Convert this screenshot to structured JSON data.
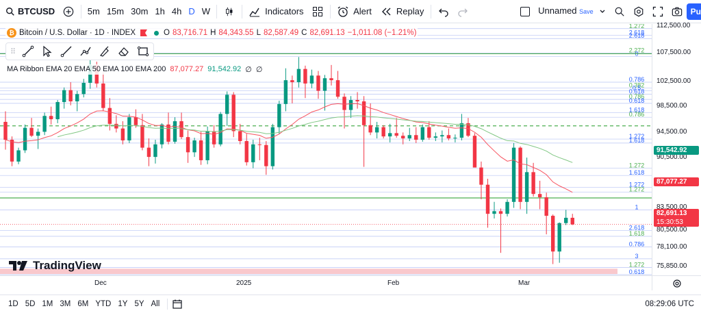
{
  "toolbar": {
    "symbol": "BTCUSD",
    "timeframes": [
      "5m",
      "15m",
      "30m",
      "1h",
      "4h",
      "D",
      "W"
    ],
    "active_timeframe": "D",
    "indicators_label": "Indicators",
    "alert_label": "Alert",
    "replay_label": "Replay",
    "layout_name": "Unnamed",
    "layout_status": "Save",
    "publish_label": "Pu"
  },
  "legend": {
    "title": "Bitcoin / U.S. Dollar · 1D · INDEX",
    "open_label": "O",
    "open": "83,716.71",
    "high_label": "H",
    "high": "84,343.55",
    "low_label": "L",
    "low": "82,587.49",
    "close_label": "C",
    "close": "82,691.13",
    "change": "−1,011.08 (−1.21%)"
  },
  "ma_legend": {
    "label": "MA Ribbon EMA 20 EMA 50 EMA 100 EMA 200",
    "v1": "87,077.27",
    "v2": "91,542.92",
    "v3": "∅",
    "v4": "∅"
  },
  "price_axis": {
    "ticks": [
      "112,500.00",
      "107,500.00",
      "102,500.00",
      "98,500.00",
      "94,500.00",
      "90,500.00",
      "83,500.00",
      "80,500.00",
      "78,100.00",
      "75,850.00"
    ],
    "tag_green": "91,542.92",
    "tag_red": "87,077.27",
    "tag_current": "82,691.13",
    "tag_timer": "15:30:53"
  },
  "time_axis": {
    "ticks": [
      "Dec",
      "2025",
      "Feb",
      "Mar"
    ]
  },
  "fib_labels": [
    "1.272",
    "2.618",
    "2.618",
    "2.272",
    "0",
    "0.786",
    "0.382",
    "0.5",
    "0.618",
    "0.786",
    "0.618",
    "1.618",
    "0.786",
    "1.272",
    "1.618",
    "1.272",
    "1.618",
    "1.272",
    "1.272",
    "1",
    "2.618",
    "1.618",
    "0.786",
    "3",
    "1.272",
    "0.618"
  ],
  "bottombar": {
    "ranges": [
      "1D",
      "5D",
      "1M",
      "3M",
      "6M",
      "YTD",
      "1Y",
      "5Y",
      "All"
    ],
    "clock": "08:29:06 UTC"
  },
  "branding": {
    "logo_text": "TradingView"
  },
  "colors": {
    "up": "#089981",
    "down": "#f23645",
    "accent": "#2962ff",
    "ema_fast": "#f7525f",
    "ema_slow": "#81c784"
  },
  "chart_data": {
    "type": "candlestick",
    "ylim": [
      75000,
      113000
    ],
    "candles": [
      [
        98200,
        99800,
        94000,
        95500
      ],
      [
        95500,
        96000,
        91500,
        92200
      ],
      [
        92200,
        94300,
        91800,
        93900
      ],
      [
        93900,
        97800,
        93500,
        97300
      ],
      [
        97300,
        98800,
        95900,
        96100
      ],
      [
        96100,
        97200,
        94100,
        96700
      ],
      [
        96700,
        99600,
        96200,
        99100
      ],
      [
        99100,
        100500,
        97800,
        98600
      ],
      [
        98600,
        101500,
        98000,
        101200
      ],
      [
        101200,
        103400,
        100200,
        103000
      ],
      [
        103000,
        104200,
        100700,
        101300
      ],
      [
        101300,
        102900,
        99800,
        102400
      ],
      [
        102400,
        104700,
        101900,
        104100
      ],
      [
        104100,
        108300,
        103200,
        106800
      ],
      [
        106800,
        107300,
        103400,
        104000
      ],
      [
        104000,
        105700,
        99800,
        100300
      ],
      [
        100300,
        101800,
        96900,
        97900
      ],
      [
        97900,
        99200,
        96600,
        97200
      ],
      [
        97200,
        98300,
        94800,
        95400
      ],
      [
        95400,
        99400,
        95000,
        98900
      ],
      [
        98900,
        100100,
        97300,
        97700
      ],
      [
        97700,
        99400,
        93900,
        94300
      ],
      [
        94300,
        95700,
        91500,
        92900
      ],
      [
        92900,
        95500,
        91900,
        94800
      ],
      [
        94800,
        98000,
        94200,
        97800
      ],
      [
        97800,
        99600,
        94800,
        95200
      ],
      [
        95200,
        98900,
        94900,
        98300
      ],
      [
        98300,
        99600,
        95600,
        95900
      ],
      [
        95900,
        96900,
        92000,
        93600
      ],
      [
        93600,
        95800,
        92900,
        95400
      ],
      [
        95400,
        96700,
        91700,
        92400
      ],
      [
        92400,
        97500,
        91800,
        96800
      ],
      [
        96800,
        97700,
        94300,
        94800
      ],
      [
        94800,
        99700,
        94500,
        99400
      ],
      [
        99400,
        102800,
        97600,
        102300
      ],
      [
        102300,
        102700,
        95900,
        96800
      ],
      [
        96800,
        97900,
        94800,
        95300
      ],
      [
        95300,
        96400,
        91600,
        92100
      ],
      [
        92100,
        95500,
        91200,
        94800
      ],
      [
        94800,
        95800,
        92400,
        94700
      ],
      [
        94700,
        95300,
        90200,
        91500
      ],
      [
        91500,
        97900,
        91000,
        97400
      ],
      [
        97400,
        101400,
        96400,
        100900
      ],
      [
        100900,
        106300,
        99800,
        104500
      ],
      [
        104500,
        105200,
        101000,
        104200
      ],
      [
        104200,
        108000,
        103400,
        106200
      ],
      [
        106200,
        106700,
        101800,
        104000
      ],
      [
        104000,
        106100,
        103300,
        105200
      ],
      [
        105200,
        105900,
        101700,
        102900
      ],
      [
        102900,
        105300,
        99900,
        104800
      ],
      [
        104800,
        106800,
        103700,
        104500
      ],
      [
        104500,
        105900,
        101700,
        102000
      ],
      [
        102000,
        102500,
        97200,
        100000
      ],
      [
        100000,
        102100,
        98800,
        101500
      ],
      [
        101500,
        102700,
        100200,
        101300
      ],
      [
        101300,
        102100,
        91400,
        97700
      ],
      [
        97700,
        101000,
        96200,
        96600
      ],
      [
        96600,
        98200,
        95700,
        97400
      ],
      [
        97400,
        97700,
        95700,
        96000
      ],
      [
        96000,
        97900,
        95100,
        96500
      ],
      [
        96500,
        98800,
        95800,
        96100
      ],
      [
        96100,
        96600,
        94800,
        95700
      ],
      [
        95700,
        97300,
        95300,
        96200
      ],
      [
        96200,
        97400,
        95000,
        95500
      ],
      [
        95500,
        97800,
        95200,
        97400
      ],
      [
        97400,
        98300,
        95500,
        95800
      ],
      [
        95800,
        96600,
        95300,
        96000
      ],
      [
        96000,
        96900,
        95100,
        96200
      ],
      [
        96200,
        97200,
        95400,
        95700
      ],
      [
        95700,
        96300,
        95100,
        95800
      ],
      [
        95800,
        99400,
        95400,
        98000
      ],
      [
        98000,
        98800,
        95900,
        96100
      ],
      [
        96100,
        96500,
        91500,
        91300
      ],
      [
        91300,
        92200,
        86500,
        88700
      ],
      [
        88700,
        89600,
        82200,
        84300
      ],
      [
        84300,
        86100,
        83600,
        84700
      ],
      [
        84700,
        85100,
        78400,
        84300
      ],
      [
        84300,
        86500,
        83900,
        86100
      ],
      [
        86100,
        95000,
        85200,
        94300
      ],
      [
        94300,
        94500,
        85000,
        86100
      ],
      [
        86100,
        92800,
        84300,
        90600
      ],
      [
        90600,
        92000,
        86900,
        87300
      ],
      [
        87300,
        89300,
        85000,
        86800
      ],
      [
        86800,
        87500,
        81200,
        84000
      ],
      [
        84000,
        84200,
        76700,
        78600
      ],
      [
        78600,
        83000,
        76900,
        82900
      ],
      [
        82900,
        84900,
        82600,
        83700
      ],
      [
        83700,
        84300,
        82600,
        82700
      ]
    ]
  }
}
